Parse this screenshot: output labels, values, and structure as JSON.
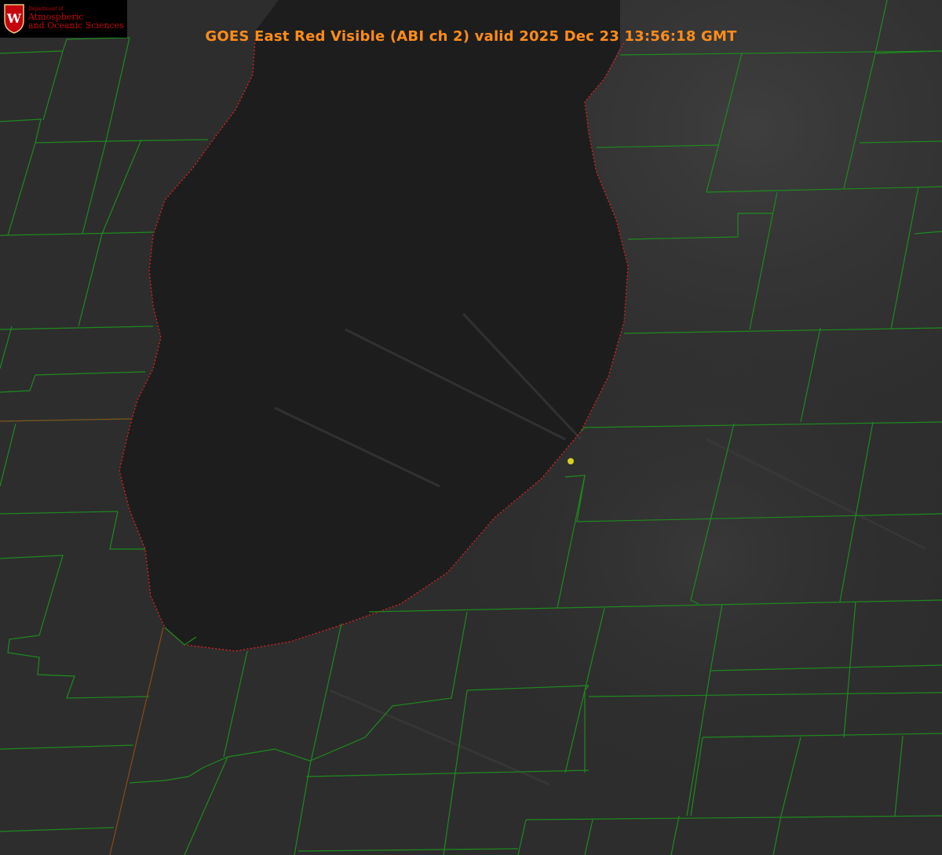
{
  "logo": {
    "dept_line": "Department of",
    "line1": "Atmospheric",
    "line2": "and Oceanic Sciences",
    "crest_letter": "W"
  },
  "title": "GOES East Red Visible (ABI ch 2) valid 2025 Dec 23 13:56:18 GMT",
  "colors": {
    "county_lines": "#1e8a1e",
    "coastline": "#d42020",
    "title": "#ff8c1a",
    "marker": "#d8d020",
    "lake": "#1c1c1c",
    "land": "#2c2c2c"
  }
}
